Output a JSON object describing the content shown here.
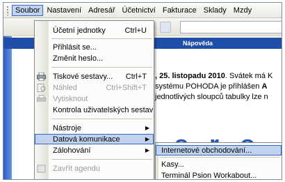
{
  "menubar": {
    "items": [
      {
        "label": "Soubor",
        "active": true
      },
      {
        "label": "Nastavení"
      },
      {
        "label": "Adresář"
      },
      {
        "label": "Účetnictví"
      },
      {
        "label": "Fakturace"
      },
      {
        "label": "Sklady"
      },
      {
        "label": "Mzdy"
      }
    ]
  },
  "content": {
    "nav_title": "Nápověda",
    "news_line1_bold": ", 25. listopadu 2010",
    "news_line1_rest": ". Svátek má K",
    "news_line2_a": " systému POHODA je přihlášen ",
    "news_line2_b": "A",
    "news_line3": " jednotlivých sloupců tabulky lze n",
    "logo": "s r o"
  },
  "dropdown": {
    "items": [
      {
        "label": "Účetní jednotky",
        "shortcut": "Ctrl+U"
      },
      {
        "label": "Přihlásit se..."
      },
      {
        "label": "Změnit heslo..."
      },
      {
        "label": "Tiskové sestavy...",
        "shortcut": "Ctrl+T"
      },
      {
        "label": "Náhled",
        "shortcut": "Ctrl+Shift+T",
        "disabled": true
      },
      {
        "label": "Vytisknout",
        "disabled": true
      },
      {
        "label": "Kontrola uživatelských sestav"
      },
      {
        "label": "Nástroje",
        "submenu": true
      },
      {
        "label": "Datová komunikace",
        "submenu": true,
        "highlight": true
      },
      {
        "label": "Zálohování",
        "submenu": true
      },
      {
        "label": "Zavřít agendu",
        "disabled": true
      }
    ]
  },
  "submenu": {
    "items": [
      {
        "label": "Internetové obchodování...",
        "highlight": true
      },
      {
        "label": "Kasy..."
      },
      {
        "label": "Terminál Psion Workabout..."
      }
    ]
  },
  "colors": {
    "highlight": "#c1d2ee",
    "highlight_border": "#316ac5",
    "nav_bar": "#1f4fa8",
    "disabled_text": "#9b9b9b"
  }
}
